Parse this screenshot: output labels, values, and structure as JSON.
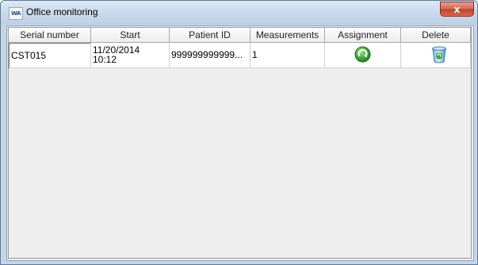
{
  "window": {
    "title": "Office monitoring",
    "close_label": "x"
  },
  "table": {
    "columns": [
      "Serial number",
      "Start",
      "Patient ID",
      "Measurements",
      "Assignment",
      "Delete"
    ],
    "rows": [
      {
        "serial": "CST015",
        "start_date": "11/20/2014",
        "start_time": "10:12",
        "patient_id": "999999999999...",
        "measurements": "1",
        "assignment_icon": "assign-arrow-icon",
        "delete_icon": "recycle-bin-icon"
      }
    ]
  },
  "colors": {
    "assign_green": "#3aa63a",
    "bin_blue": "#4a90c8"
  }
}
